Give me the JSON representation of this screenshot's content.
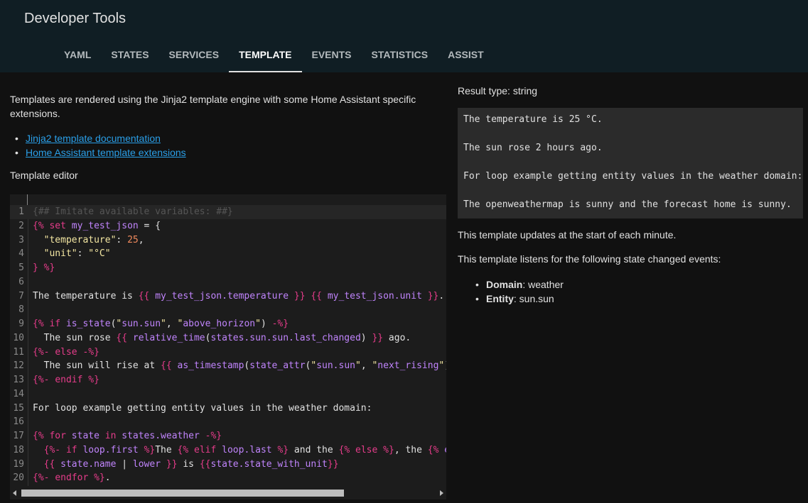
{
  "header": {
    "title": "Developer Tools",
    "tabs": [
      {
        "label": "YAML"
      },
      {
        "label": "STATES"
      },
      {
        "label": "SERVICES"
      },
      {
        "label": "TEMPLATE"
      },
      {
        "label": "EVENTS"
      },
      {
        "label": "STATISTICS"
      },
      {
        "label": "ASSIST"
      }
    ],
    "active_tab": "TEMPLATE"
  },
  "left": {
    "intro": "Templates are rendered using the Jinja2 template engine with some Home Assistant specific extensions.",
    "links": [
      {
        "label": "Jinja2 template documentation"
      },
      {
        "label": "Home Assistant template extensions"
      }
    ],
    "editor_label": "Template editor"
  },
  "editor": {
    "line_numbers": [
      "1",
      "2",
      "3",
      "4",
      "5",
      "6",
      "7",
      "8",
      "9",
      "10",
      "11",
      "12",
      "13",
      "14",
      "15",
      "16",
      "17",
      "18",
      "19",
      "20"
    ],
    "lines": [
      "{## Imitate available variables: ##}",
      "{% set my_test_json = {",
      "  \"temperature\": 25,",
      "  \"unit\": \"°C\"",
      "} %}",
      "",
      "The temperature is {{ my_test_json.temperature }} {{ my_test_json.unit }}.",
      "",
      "{% if is_state(\"sun.sun\", \"above_horizon\") -%}",
      "  The sun rose {{ relative_time(states.sun.sun.last_changed) }} ago.",
      "{%- else -%}",
      "  The sun will rise at {{ as_timestamp(state_attr(\"sun.sun\", \"next_rising\"))",
      "{%- endif %}",
      "",
      "For loop example getting entity values in the weather domain:",
      "",
      "{% for state in states.weather -%}",
      "  {%- if loop.first %}The {% elif loop.last %} and the {% else %}, the {% en",
      "  {{ state.name | lower }} is {{state.state_with_unit}}",
      "{%- endfor %}."
    ]
  },
  "right": {
    "result_type": "Result type: string",
    "result_lines": [
      "The temperature is 25 °C.",
      "The sun rose 2 hours ago.",
      "For loop example getting entity values in the weather domain:",
      "The openweathermap is sunny and the forecast home is sunny."
    ],
    "updates_text": "This template updates at the start of each minute.",
    "listens_text": "This template listens for the following state changed events:",
    "events": [
      {
        "key": "Domain",
        "value": ": weather"
      },
      {
        "key": "Entity",
        "value": ": sun.sun"
      }
    ]
  },
  "colors": {
    "header_bg": "#101e24",
    "page_bg": "#111111",
    "link": "#2a9fe8",
    "jinja_tag": "#e53c8a",
    "jinja_var": "#c084fc",
    "string": "#f4e7a2",
    "number": "#f08a5d"
  }
}
